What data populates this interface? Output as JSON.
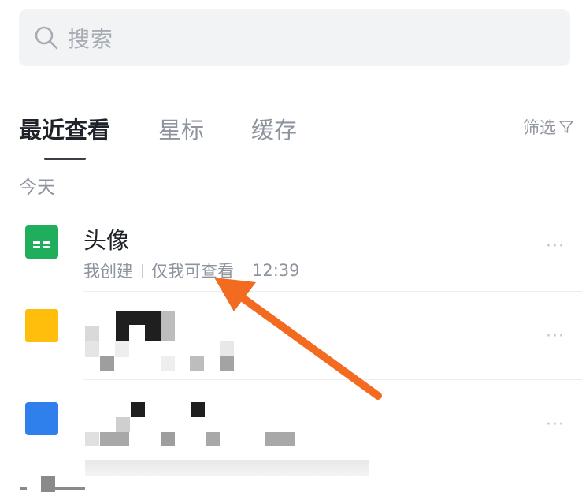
{
  "search": {
    "placeholder": "搜索"
  },
  "tabs": [
    {
      "label": "最近查看",
      "active": true
    },
    {
      "label": "星标",
      "active": false
    },
    {
      "label": "缓存",
      "active": false
    }
  ],
  "filter": {
    "label": "筛选"
  },
  "section": {
    "label": "今天"
  },
  "files": [
    {
      "title": "头像",
      "meta": [
        "我创建",
        "仅我可查看",
        "12:39"
      ],
      "icon": "sheet-icon",
      "icon_color": "#1fae5b"
    },
    {
      "title": "",
      "meta": [],
      "icon": "folder-icon",
      "icon_color": "#ffbe0b",
      "redacted": true
    },
    {
      "title": "",
      "meta": [],
      "icon": "doc-icon",
      "icon_color": "#2f80ed",
      "redacted": true
    }
  ],
  "more_label": "···",
  "colors": {
    "arrow": "#f26b21",
    "accent_text": "#1f2329",
    "secondary_text": "#8f959e"
  }
}
